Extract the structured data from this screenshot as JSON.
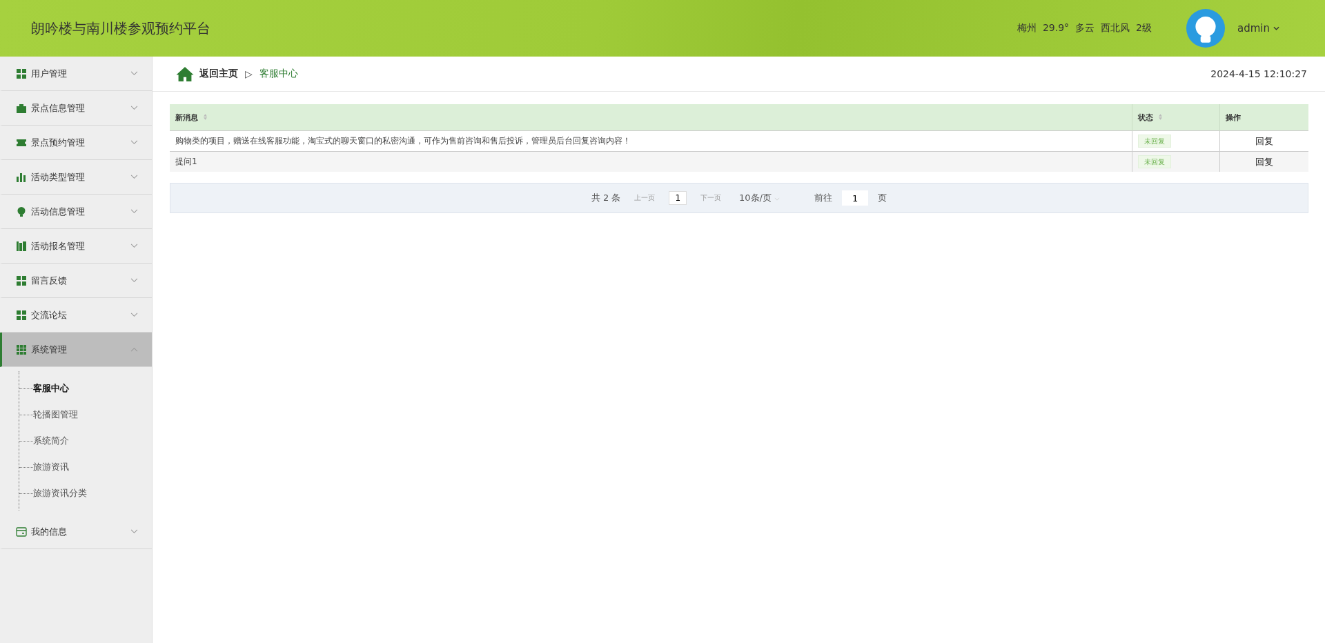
{
  "header": {
    "title": "朗吟楼与南川楼参观预约平台",
    "weather": [
      "梅州",
      "29.9°",
      "多云",
      "西北风",
      "2级"
    ],
    "user": "admin"
  },
  "sidebar": {
    "items": [
      {
        "label": "用户管理",
        "expanded": false
      },
      {
        "label": "景点信息管理",
        "expanded": false
      },
      {
        "label": "景点预约管理",
        "expanded": false
      },
      {
        "label": "活动类型管理",
        "expanded": false
      },
      {
        "label": "活动信息管理",
        "expanded": false
      },
      {
        "label": "活动报名管理",
        "expanded": false
      },
      {
        "label": "留言反馈",
        "expanded": false
      },
      {
        "label": "交流论坛",
        "expanded": false
      },
      {
        "label": "系统管理",
        "expanded": true,
        "children": [
          {
            "label": "客服中心",
            "selected": true
          },
          {
            "label": "轮播图管理",
            "selected": false
          },
          {
            "label": "系统简介",
            "selected": false
          },
          {
            "label": "旅游资讯",
            "selected": false
          },
          {
            "label": "旅游资讯分类",
            "selected": false
          }
        ]
      },
      {
        "label": "我的信息",
        "expanded": false
      }
    ]
  },
  "breadcrumb": {
    "home": "返回主页",
    "separator": "▷",
    "current": "客服中心",
    "datetime": "2024-4-15 12:10:27"
  },
  "table": {
    "columns": [
      "新消息",
      "状态",
      "操作"
    ],
    "rows": [
      {
        "message": "购物类的项目，赠送在线客服功能，淘宝式的聊天窗口的私密沟通，可作为售前咨询和售后投诉，管理员后台回复咨询内容！",
        "status": "未回复",
        "action": "回复"
      },
      {
        "message": "提问1",
        "status": "未回复",
        "action": "回复"
      }
    ]
  },
  "pagination": {
    "total": "共 2 条",
    "prev": "上一页",
    "page": "1",
    "next": "下一页",
    "page_size": "10条/页",
    "goto": "前往",
    "goto_value": "1",
    "goto_suffix": "页"
  }
}
